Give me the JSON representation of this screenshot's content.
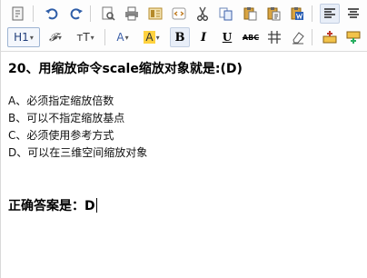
{
  "toolbar": {
    "row1": [
      {
        "name": "source-icon"
      },
      {
        "name": "undo-icon"
      },
      {
        "name": "redo-icon"
      },
      {
        "name": "preview-icon"
      },
      {
        "name": "print-icon"
      },
      {
        "name": "template-icon"
      },
      {
        "name": "code-icon"
      },
      {
        "name": "cut-icon"
      },
      {
        "name": "copy-icon"
      },
      {
        "name": "paste-icon"
      },
      {
        "name": "paste-text-icon"
      },
      {
        "name": "paste-word-icon"
      },
      {
        "name": "align-left-icon"
      },
      {
        "name": "align-center-icon"
      }
    ],
    "heading_label": "H1",
    "font_family_label": "𝒻",
    "font_size_label": "тT",
    "forecolor_label": "A",
    "hilitecolor_label": "A",
    "bold_label": "B",
    "italic_label": "I",
    "underline_label": "U",
    "strikethrough_label": "ABC",
    "colors": {
      "accent": "#4a78c2",
      "highlight": "#ffd23f",
      "forecolor_bar": "#3b5fa8"
    }
  },
  "content": {
    "question_title": "20、用缩放命令scale缩放对象就是:(D)",
    "options": [
      "A、必须指定缩放倍数",
      "B、可以不指定缩放基点",
      "C、必须使用参考方式",
      "D、可以在三维空间缩放对象"
    ],
    "answer": "正确答案是：D"
  }
}
